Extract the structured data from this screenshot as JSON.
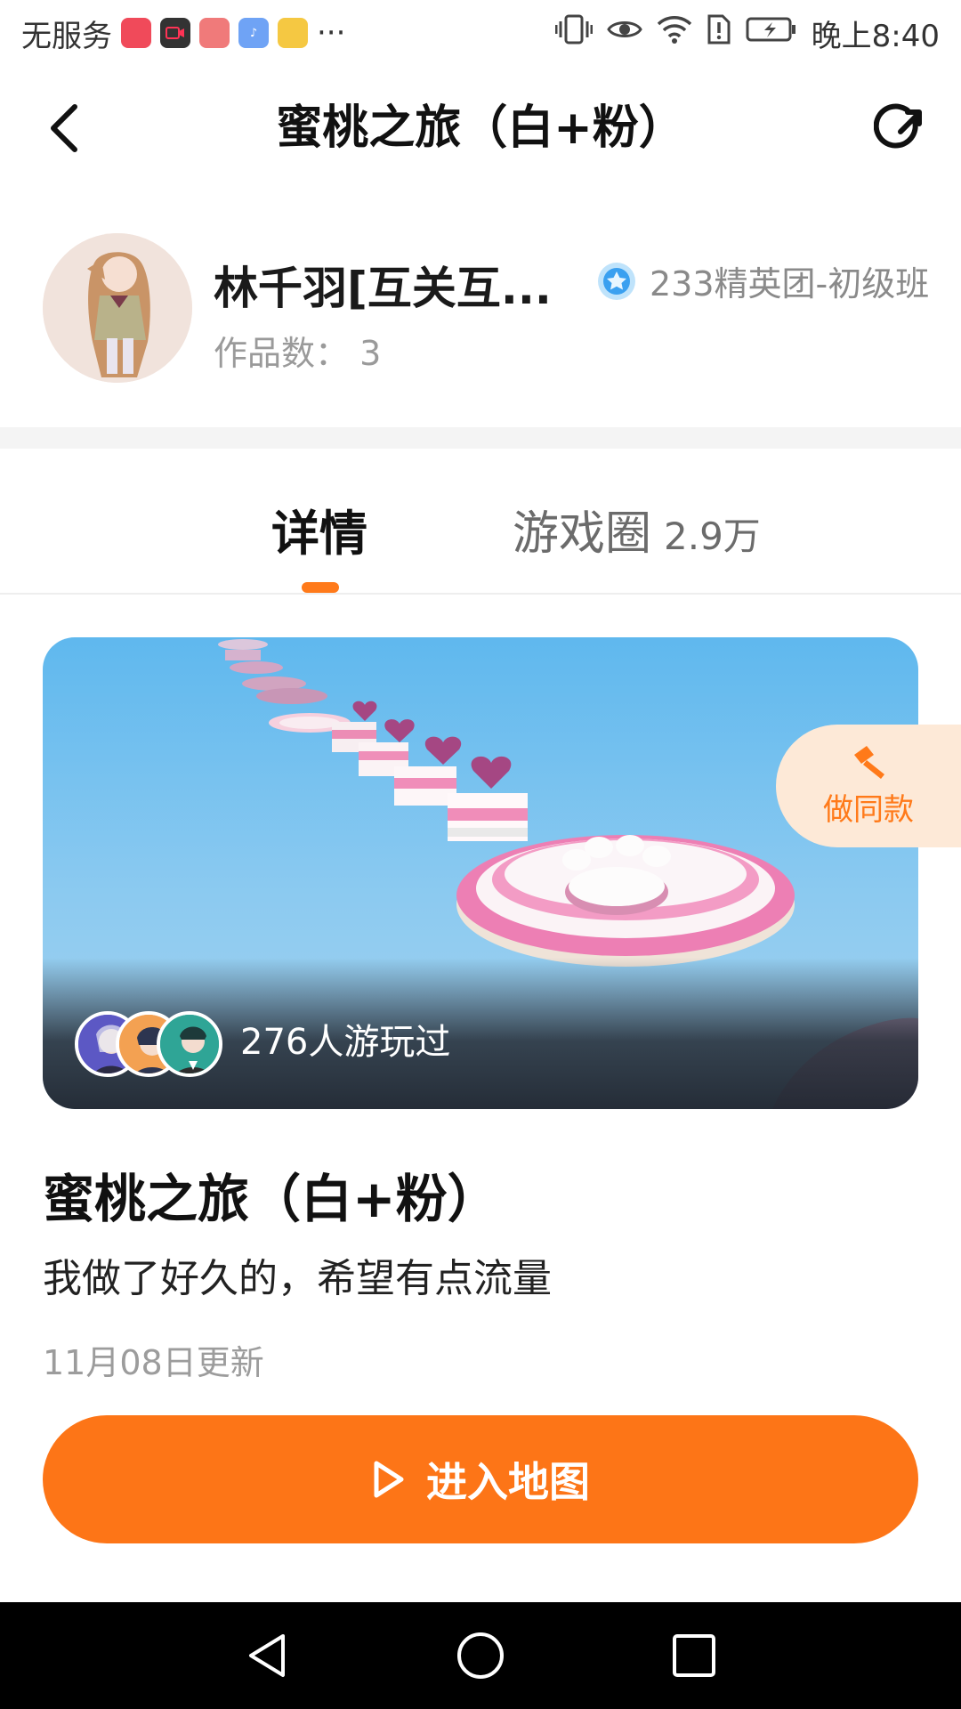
{
  "status_bar": {
    "carrier": "无服务",
    "app_icons": [
      "小红书",
      "视频",
      "堆糖",
      "音乐",
      "文件"
    ],
    "more": "···",
    "time": "晚上8:40"
  },
  "header": {
    "title": "蜜桃之旅（白+粉）"
  },
  "author": {
    "name": "林千羽[互关互...",
    "badge": "233精英团-初级班",
    "works": "作品数：  3"
  },
  "tabs": {
    "detail": "详情",
    "circle": "游戏圈",
    "circle_count": "2.9万",
    "active": "detail"
  },
  "hero": {
    "players_text": "276人游玩过"
  },
  "make_same": {
    "label": "做同款"
  },
  "game": {
    "title": "蜜桃之旅（白+粉）",
    "description": "我做了好久的，希望有点流量",
    "updated": "11月08日更新"
  },
  "actions": {
    "enter_map": "进入地图"
  },
  "colors": {
    "accent": "#fd7517",
    "accent_light": "#fde9d7",
    "badge_blue": "#3aa0f0"
  }
}
